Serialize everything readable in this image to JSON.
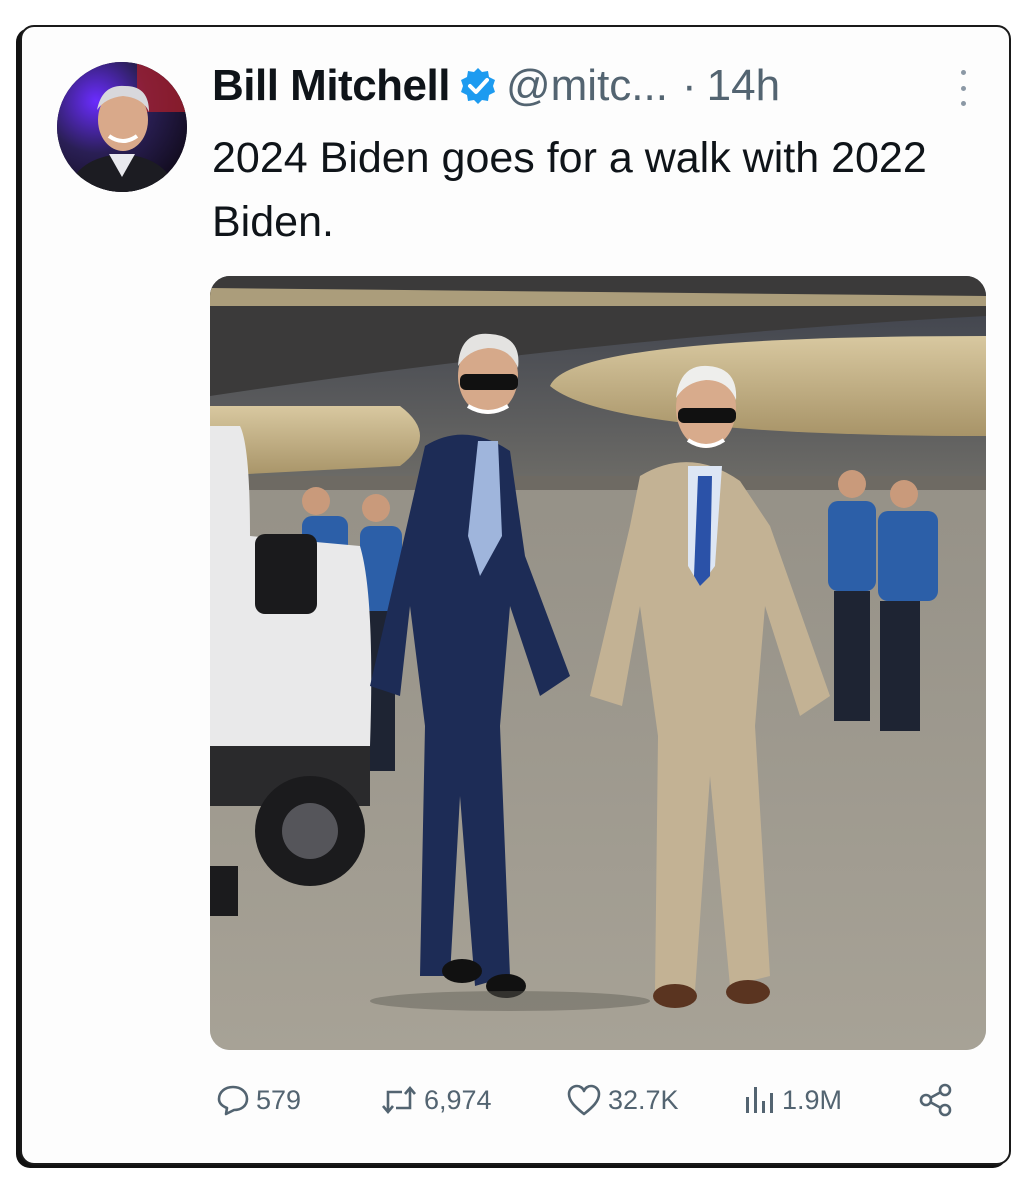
{
  "tweet": {
    "author_name": "Bill Mitchell",
    "handle": "@mitc...",
    "separator": "·",
    "time": "14h",
    "text": "2024 Biden goes for a walk with 2022 Biden.",
    "verified": true
  },
  "actions": {
    "replies": "579",
    "retweets": "6,974",
    "likes": "32.7K",
    "views": "1.9M"
  },
  "icons": {
    "verified": "verified-badge-icon",
    "more": "more-options-icon",
    "reply": "reply-icon",
    "retweet": "retweet-icon",
    "like": "heart-icon",
    "views": "views-bar-chart-icon",
    "share": "share-icon"
  },
  "colors": {
    "text_primary": "#0f1419",
    "text_secondary": "#536471",
    "verified_blue": "#1d9bf0"
  }
}
